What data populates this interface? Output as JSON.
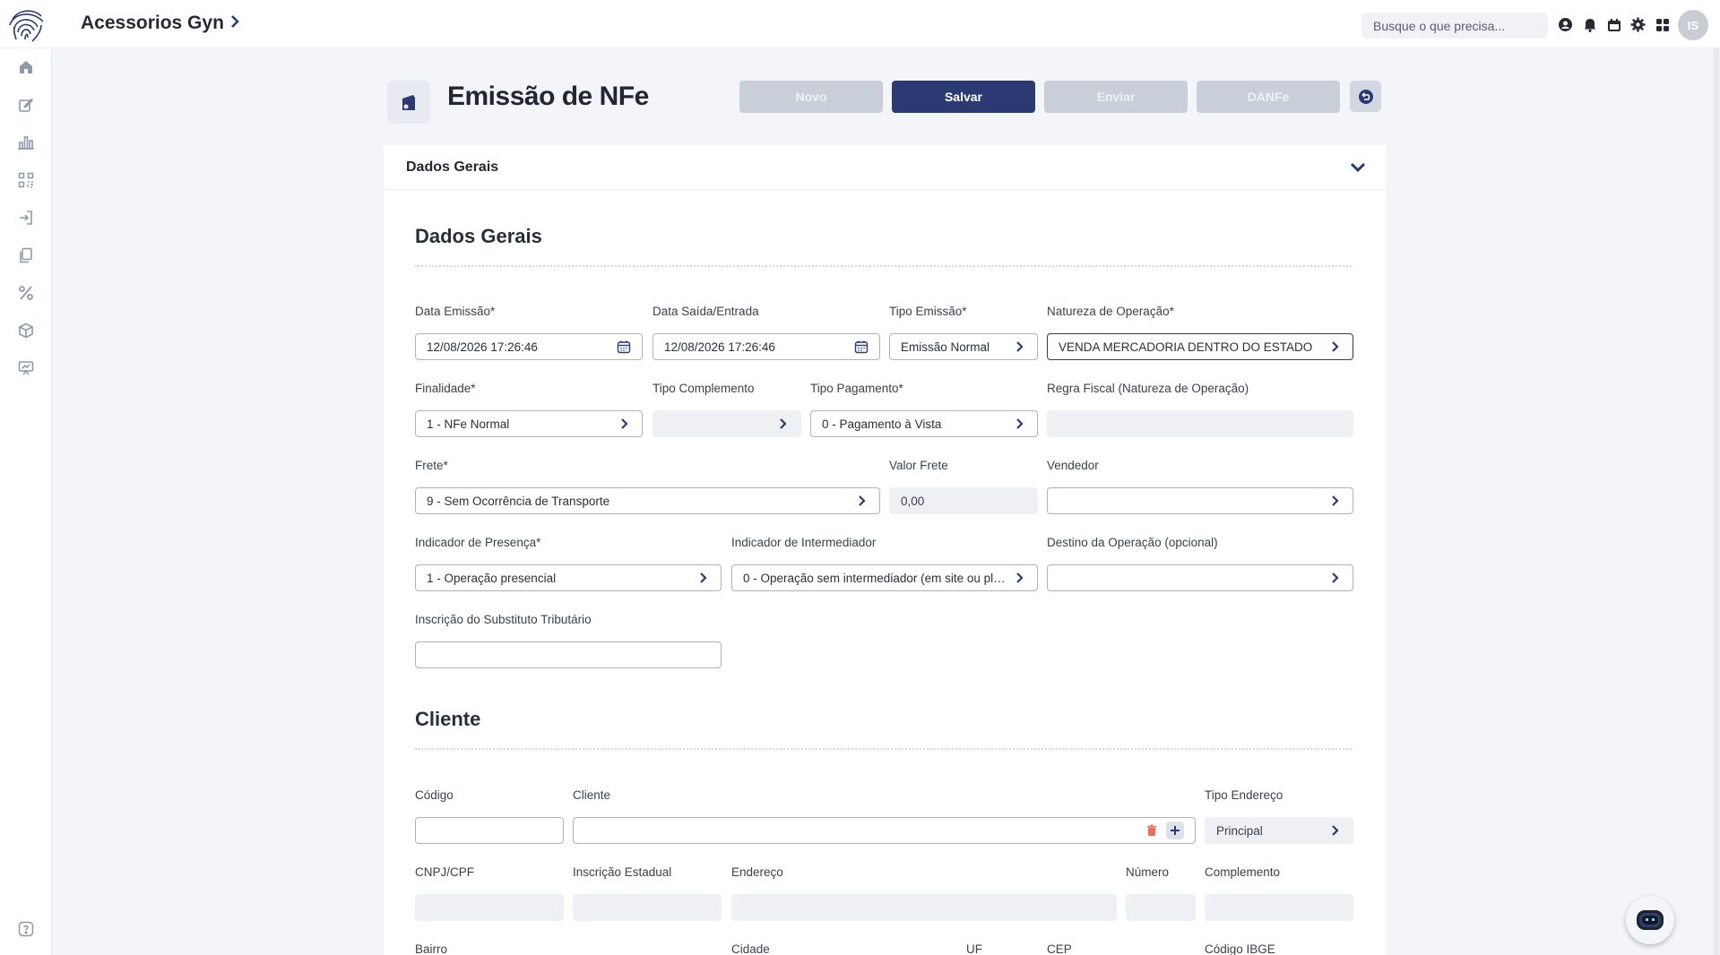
{
  "header": {
    "company": "Acessorios Gyn",
    "search_placeholder": "Busque o que precisa...",
    "avatar_initials": "IS"
  },
  "sidebar": {
    "items": [
      "home",
      "edit",
      "reports",
      "qrcode",
      "login",
      "documents",
      "percent",
      "box",
      "presentation"
    ],
    "help": "help"
  },
  "page": {
    "title": "Emissão de NFe",
    "buttons": {
      "novo": "Novo",
      "salvar": "Salvar",
      "enviar": "Enviar",
      "danfe": "DANFe"
    }
  },
  "panel": {
    "header_title": "Dados Gerais"
  },
  "dados_gerais": {
    "section_title": "Dados Gerais",
    "data_emissao": {
      "label": "Data Emissão*",
      "value": "12/08/2026 17:26:46"
    },
    "data_saida": {
      "label": "Data Saída/Entrada",
      "value": "12/08/2026 17:26:46"
    },
    "tipo_emissao": {
      "label": "Tipo Emissão*",
      "value": "Emissão Normal"
    },
    "natureza": {
      "label": "Natureza de Operação*",
      "value": "VENDA MERCADORIA DENTRO DO ESTADO"
    },
    "finalidade": {
      "label": "Finalidade*",
      "value": "1 - NFe Normal"
    },
    "tipo_complemento": {
      "label": "Tipo Complemento",
      "value": ""
    },
    "tipo_pagamento": {
      "label": "Tipo Pagamento*",
      "value": "0 - Pagamento à Vista"
    },
    "regra_fiscal": {
      "label": "Regra Fiscal (Natureza de Operação)",
      "value": ""
    },
    "frete": {
      "label": "Frete*",
      "value": "9 - Sem Ocorrência de Transporte"
    },
    "valor_frete": {
      "label": "Valor Frete",
      "value": "0,00"
    },
    "vendedor": {
      "label": "Vendedor",
      "value": ""
    },
    "indicador_presenca": {
      "label": "Indicador de Presença*",
      "value": "1 - Operação presencial"
    },
    "indicador_intermediador": {
      "label": "Indicador de Intermediador",
      "value": "0 - Operação sem intermediador (em site ou plat..."
    },
    "destino_operacao": {
      "label": "Destino da Operação (opcional)",
      "value": ""
    },
    "inscricao_st": {
      "label": "Inscrição do Substituto Tributário",
      "value": ""
    }
  },
  "cliente": {
    "section_title": "Cliente",
    "codigo": {
      "label": "Código",
      "value": ""
    },
    "cliente": {
      "label": "Cliente",
      "value": ""
    },
    "tipo_endereco": {
      "label": "Tipo Endereço",
      "value": "Principal"
    },
    "cnpj_cpf": {
      "label": "CNPJ/CPF",
      "value": ""
    },
    "inscricao_estadual": {
      "label": "Inscrição Estadual",
      "value": ""
    },
    "endereco": {
      "label": "Endereço",
      "value": ""
    },
    "numero": {
      "label": "Número",
      "value": ""
    },
    "complemento": {
      "label": "Complemento",
      "value": ""
    },
    "bairro": {
      "label": "Bairro"
    },
    "cidade": {
      "label": "Cidade"
    },
    "uf": {
      "label": "UF"
    },
    "cep": {
      "label": "CEP"
    },
    "codigo_ibge": {
      "label": "Código IBGE"
    }
  },
  "colors": {
    "primary": "#2b3a73",
    "disabled_button": "#c9cfd9",
    "field_border": "#aeb3bf",
    "readonly_bg": "#eff0f3"
  }
}
